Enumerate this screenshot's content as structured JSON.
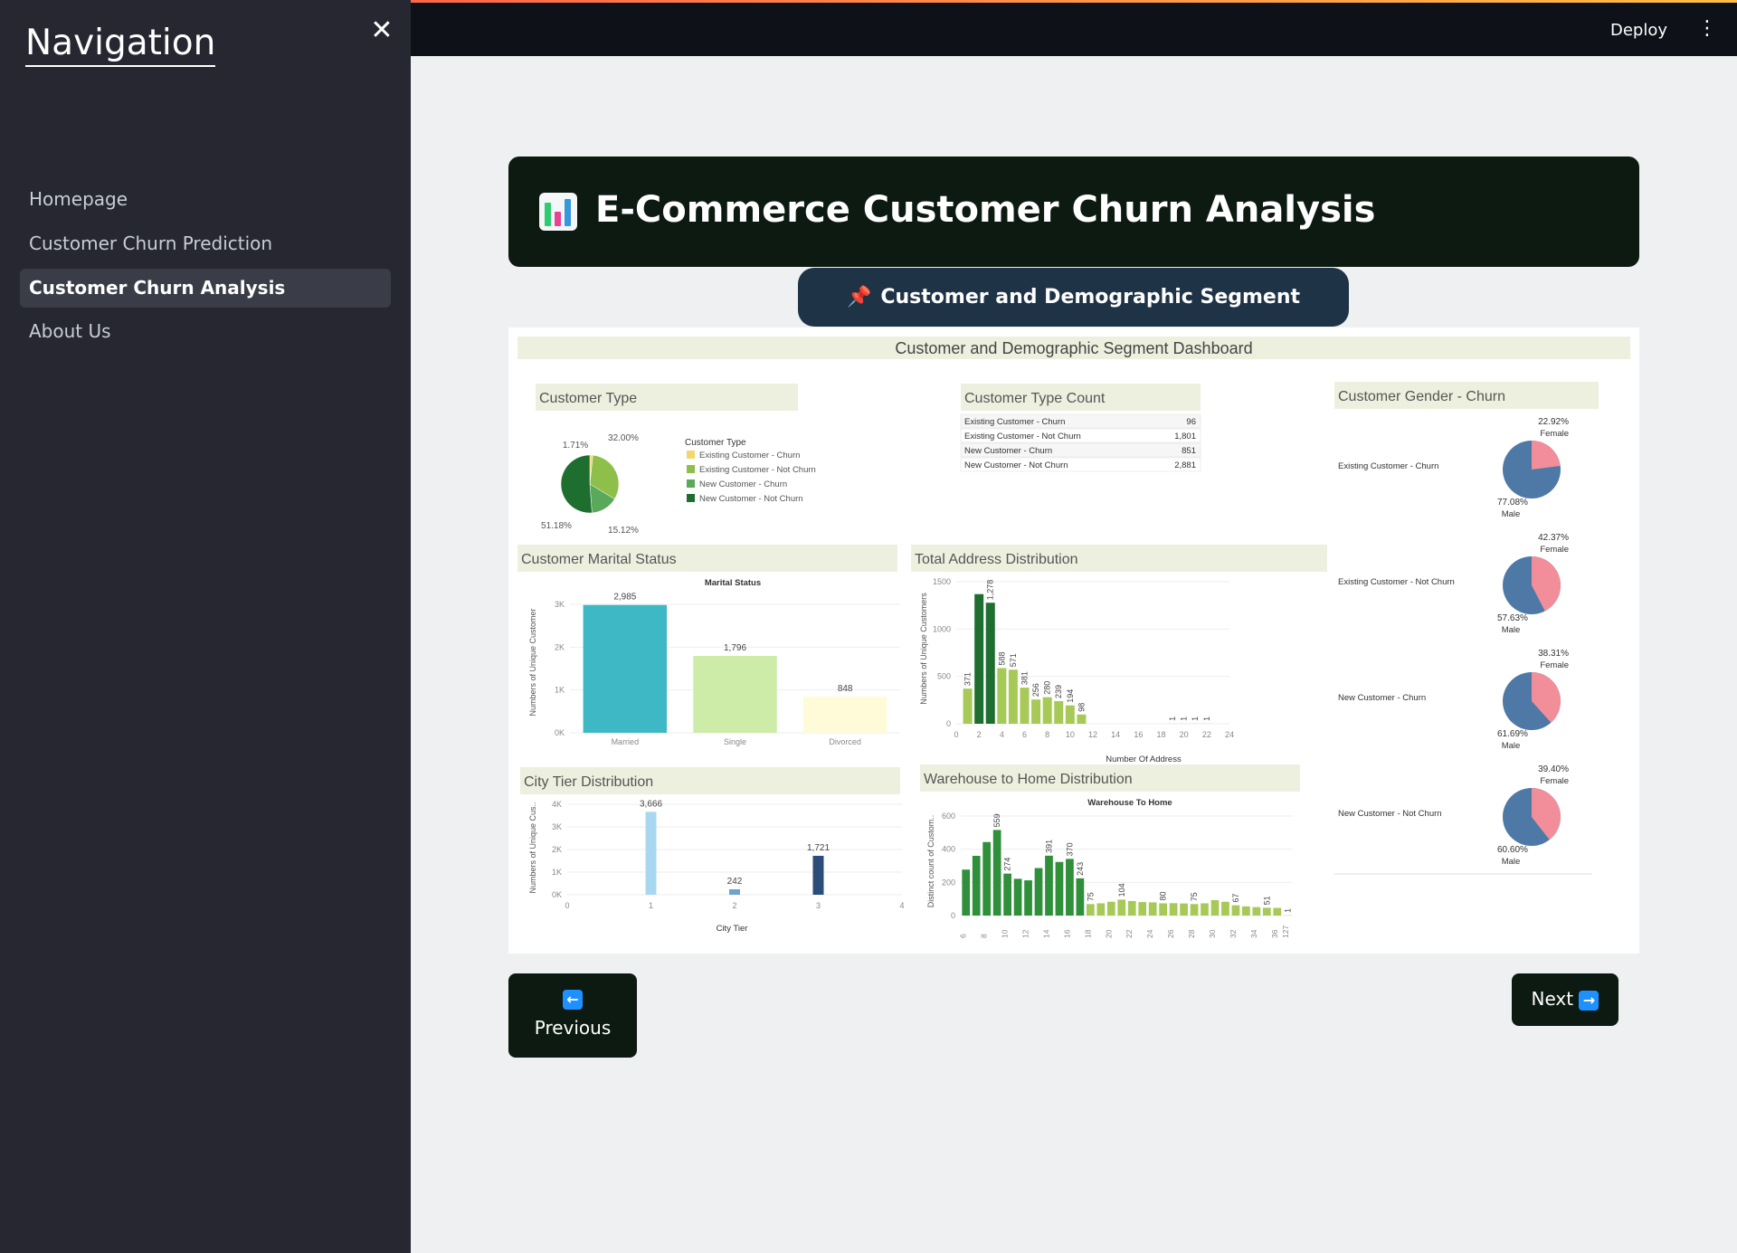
{
  "sidebar": {
    "title": "Navigation",
    "items": [
      {
        "label": "Homepage",
        "active": false
      },
      {
        "label": "Customer Churn Prediction",
        "active": false
      },
      {
        "label": "Customer Churn Analysis",
        "active": true
      },
      {
        "label": "About Us",
        "active": false
      }
    ]
  },
  "header": {
    "deploy_label": "Deploy"
  },
  "banner": {
    "title": "E-Commerce Customer Churn Analysis"
  },
  "subheader": {
    "label": "Customer and Demographic Segment Dashboard"
  },
  "buttons": {
    "previous": "Previous",
    "next": "Next"
  },
  "colors": {
    "sidebar_bg": "#262730",
    "banner_bg": "#0c1a12",
    "pill_bg": "#1f3347",
    "churn": "#f2d76a",
    "not_churn": "#8ebf4a"
  },
  "dashboard": {
    "title": "Customer and Demographic Segment Dashboard",
    "customer_type": {
      "title": "Customer Type",
      "legend_title": "Customer Type",
      "legend": [
        "Existing Customer - Churn",
        "Existing Customer - Not Churn",
        "New Customer - Churn",
        "New Customer - Not Churn"
      ],
      "labels": [
        "1.71%",
        "32.00%",
        "15.12%",
        "51.18%"
      ]
    },
    "type_count": {
      "title": "Customer Type Count",
      "rows": [
        {
          "label": "Existing Customer - Churn",
          "value": "96"
        },
        {
          "label": "Existing Customer - Not Churn",
          "value": "1,801"
        },
        {
          "label": "New Customer - Churn",
          "value": "851"
        },
        {
          "label": "New Customer - Not Churn",
          "value": "2,881"
        }
      ]
    },
    "gender": {
      "title": "Customer Gender - Churn",
      "groups": [
        {
          "label": "Existing Customer - Churn",
          "female": "22.92%",
          "male": "77.08%"
        },
        {
          "label": "Existing Customer - Not Churn",
          "female": "42.37%",
          "male": "57.63%"
        },
        {
          "label": "New Customer - Churn",
          "female": "38.31%",
          "male": "61.69%"
        },
        {
          "label": "New Customer - Not Churn",
          "female": "39.40%",
          "male": "60.60%"
        }
      ],
      "female_label": "Female",
      "male_label": "Male"
    }
  },
  "chart_data": [
    {
      "type": "pie",
      "title": "Customer Type",
      "categories": [
        "Existing Customer - Churn",
        "Existing Customer - Not Churn",
        "New Customer - Churn",
        "New Customer - Not Churn"
      ],
      "values": [
        1.71,
        32.0,
        15.12,
        51.18
      ]
    },
    {
      "type": "bar",
      "title": "Customer Marital Status",
      "subtitle": "Marital Status",
      "categories": [
        "Married",
        "Single",
        "Divorced"
      ],
      "values": [
        2985,
        1796,
        848
      ],
      "ylabel": "Numbers of Unique Customer",
      "yticks": [
        "0K",
        "1K",
        "2K",
        "3K"
      ],
      "ylim": [
        0,
        3000
      ]
    },
    {
      "type": "bar",
      "title": "Total Address Distribution",
      "xlabel": "Number Of Address",
      "ylabel": "Numbers of Unique Customers",
      "x": [
        1,
        2,
        3,
        4,
        5,
        6,
        7,
        8,
        9,
        10,
        11,
        19,
        20,
        21,
        22
      ],
      "values": [
        371,
        1369,
        1278,
        588,
        571,
        381,
        256,
        280,
        239,
        194,
        98,
        1,
        1,
        1,
        1
      ],
      "xticks": [
        "0",
        "2",
        "4",
        "6",
        "8",
        "10",
        "12",
        "14",
        "16",
        "18",
        "20",
        "22",
        "24"
      ],
      "yticks": [
        "0",
        "500",
        "1000",
        "1500"
      ],
      "ylim": [
        0,
        1500
      ]
    },
    {
      "type": "bar",
      "title": "City Tier Distribution",
      "xlabel": "City Tier",
      "ylabel": "Numbers of Unique Cus..",
      "x": [
        1,
        2,
        3
      ],
      "values": [
        3666,
        242,
        1721
      ],
      "xticks": [
        "0",
        "1",
        "2",
        "3",
        "4"
      ],
      "yticks": [
        "0K",
        "1K",
        "2K",
        "3K",
        "4K"
      ],
      "ylim": [
        0,
        4000
      ]
    },
    {
      "type": "bar",
      "title": "Warehouse to Home Distribution",
      "subtitle": "Warehouse To Home",
      "ylabel": "Distinct count of Custom..",
      "x": [
        6,
        7,
        8,
        9,
        10,
        11,
        12,
        13,
        14,
        15,
        16,
        17,
        18,
        19,
        20,
        21,
        22,
        23,
        24,
        25,
        26,
        27,
        28,
        29,
        30,
        31,
        32,
        33,
        34,
        35,
        36,
        127
      ],
      "values": [
        300,
        390,
        480,
        559,
        274,
        240,
        230,
        310,
        391,
        350,
        370,
        243,
        75,
        80,
        90,
        104,
        95,
        88,
        86,
        80,
        81,
        79,
        75,
        80,
        101,
        90,
        67,
        60,
        55,
        51,
        50,
        1
      ],
      "xticks": [
        "6",
        "8",
        "10",
        "12",
        "14",
        "16",
        "18",
        "20",
        "22",
        "24",
        "26",
        "28",
        "30",
        "32",
        "34",
        "36",
        "127"
      ],
      "yticks": [
        "0",
        "200",
        "400",
        "600"
      ],
      "ylim": [
        0,
        650
      ]
    }
  ]
}
